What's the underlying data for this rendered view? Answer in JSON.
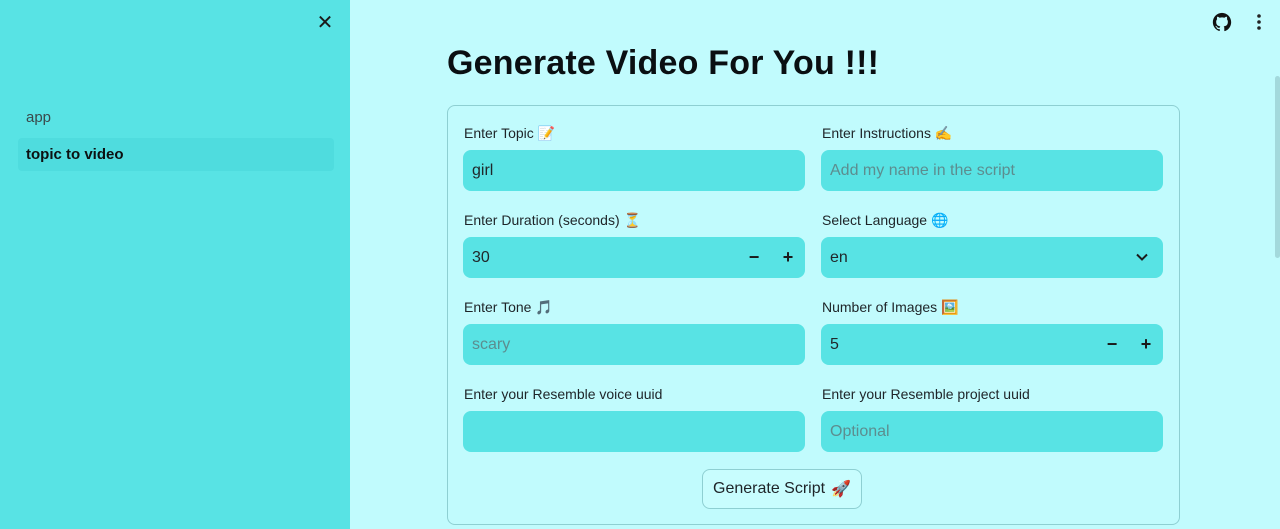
{
  "sidebar": {
    "items": [
      {
        "label": "app"
      },
      {
        "label": "topic to video"
      }
    ],
    "active_item": "topic to video",
    "close_icon": "close-icon"
  },
  "toolbar": {
    "icons": [
      "github-icon",
      "more-vertical-icon"
    ]
  },
  "page": {
    "title": "Generate Video For You !!!"
  },
  "form": {
    "topic": {
      "label": "Enter Topic",
      "emoji": "📝",
      "value": "girl"
    },
    "instructions": {
      "label": "Enter Instructions",
      "emoji": "✍️",
      "placeholder": "Add my name in the script"
    },
    "duration": {
      "label": "Enter Duration (seconds)",
      "emoji": "⏳",
      "value": "30",
      "minus": "−",
      "plus": "+"
    },
    "language": {
      "label": "Select Language",
      "emoji": "🌐",
      "selected": "en"
    },
    "tone": {
      "label": "Enter Tone",
      "emoji": "🎵",
      "placeholder": "scary"
    },
    "images": {
      "label": "Number of Images",
      "emoji": "🖼️",
      "value": "5",
      "minus": "−",
      "plus": "+"
    },
    "voice_uuid": {
      "label": "Enter your Resemble voice uuid",
      "value": ""
    },
    "project_uuid": {
      "label": "Enter your Resemble project uuid",
      "placeholder": "Optional"
    },
    "submit": {
      "label": "Generate Script",
      "emoji": "🚀"
    }
  },
  "colors": {
    "sidebar_bg": "#58e3e4",
    "main_bg": "#c1fbfd",
    "field_bg": "#58e3e4",
    "sidebar_active": "#4fdcde"
  }
}
